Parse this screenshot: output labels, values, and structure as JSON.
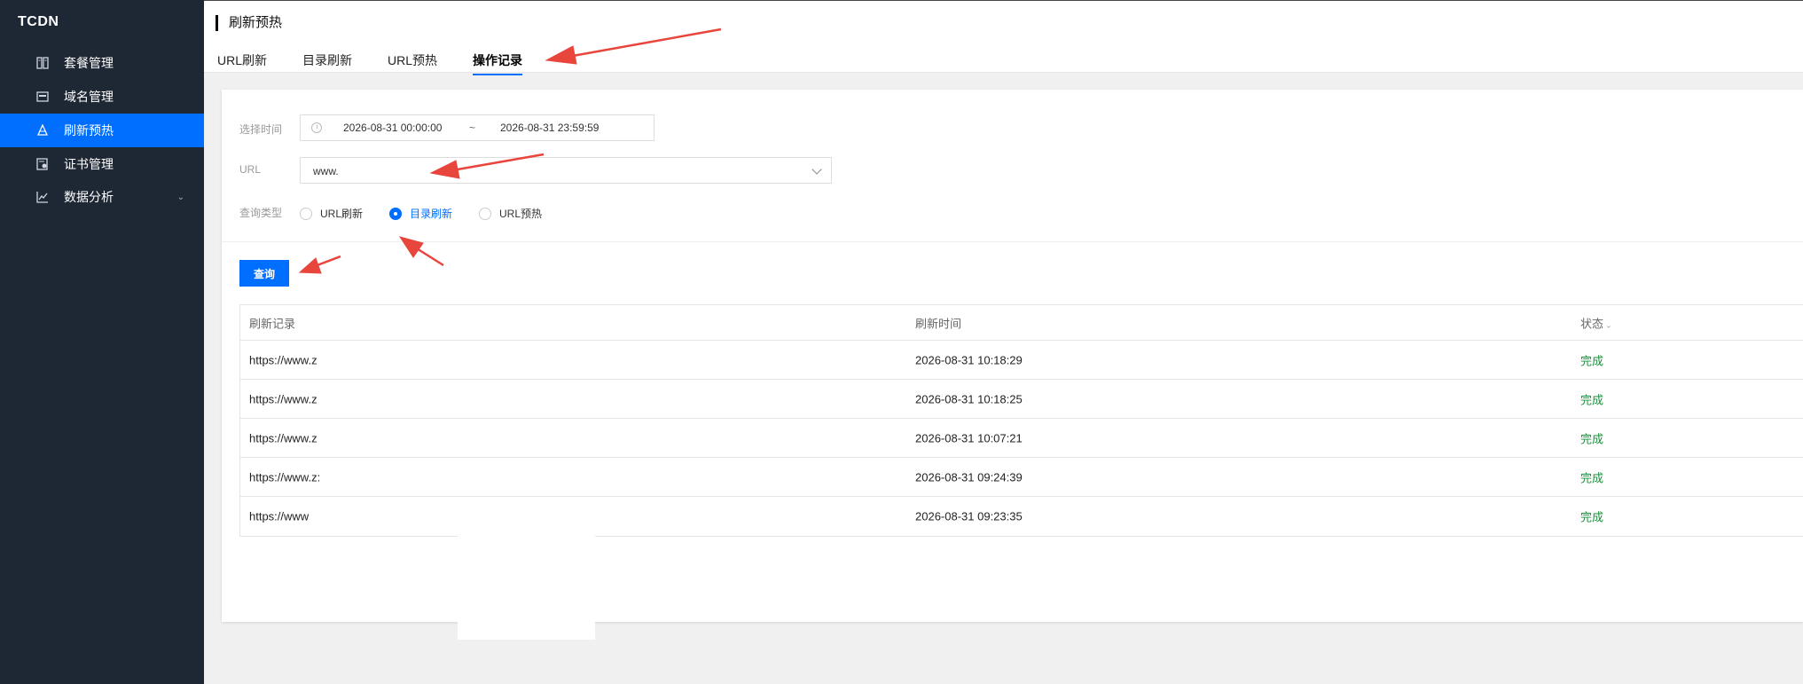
{
  "brand": "TCDN",
  "sidebar": {
    "items": [
      {
        "label": "套餐管理",
        "icon": "package-icon"
      },
      {
        "label": "域名管理",
        "icon": "domain-icon"
      },
      {
        "label": "刷新预热",
        "icon": "refresh-icon",
        "active": true
      },
      {
        "label": "证书管理",
        "icon": "certificate-icon"
      },
      {
        "label": "数据分析",
        "icon": "chart-icon",
        "expandable": true
      }
    ]
  },
  "header": {
    "title": "刷新预热",
    "tabs": [
      {
        "label": "URL刷新"
      },
      {
        "label": "目录刷新"
      },
      {
        "label": "URL预热"
      },
      {
        "label": "操作记录",
        "active": true
      }
    ]
  },
  "filters": {
    "time_label": "选择时间",
    "start_time": "2026-08-31 00:00:00",
    "range_sep": "~",
    "end_time": "2026-08-31 23:59:59",
    "url_label": "URL",
    "url_value": "www.",
    "type_label": "查询类型",
    "types": [
      {
        "label": "URL刷新",
        "checked": false
      },
      {
        "label": "目录刷新",
        "checked": true
      },
      {
        "label": "URL预热",
        "checked": false
      }
    ],
    "query_button": "查询"
  },
  "table": {
    "headers": [
      "刷新记录",
      "刷新时间",
      "状态"
    ],
    "rows": [
      {
        "record": "https://www.z",
        "time": "2026-08-31 10:18:29",
        "status": "完成"
      },
      {
        "record": "https://www.z",
        "time": "2026-08-31 10:18:25",
        "status": "完成"
      },
      {
        "record": "https://www.z",
        "time": "2026-08-31 10:07:21",
        "status": "完成"
      },
      {
        "record": "https://www.z:",
        "time": "2026-08-31 09:24:39",
        "status": "完成"
      },
      {
        "record": "https://www",
        "time": "2026-08-31 09:23:35",
        "status": "完成"
      }
    ]
  },
  "colors": {
    "sidebar_bg": "#1e2734",
    "accent": "#006eff",
    "status_done": "#1a8f3c",
    "annotation_arrow": "#e8453c"
  }
}
